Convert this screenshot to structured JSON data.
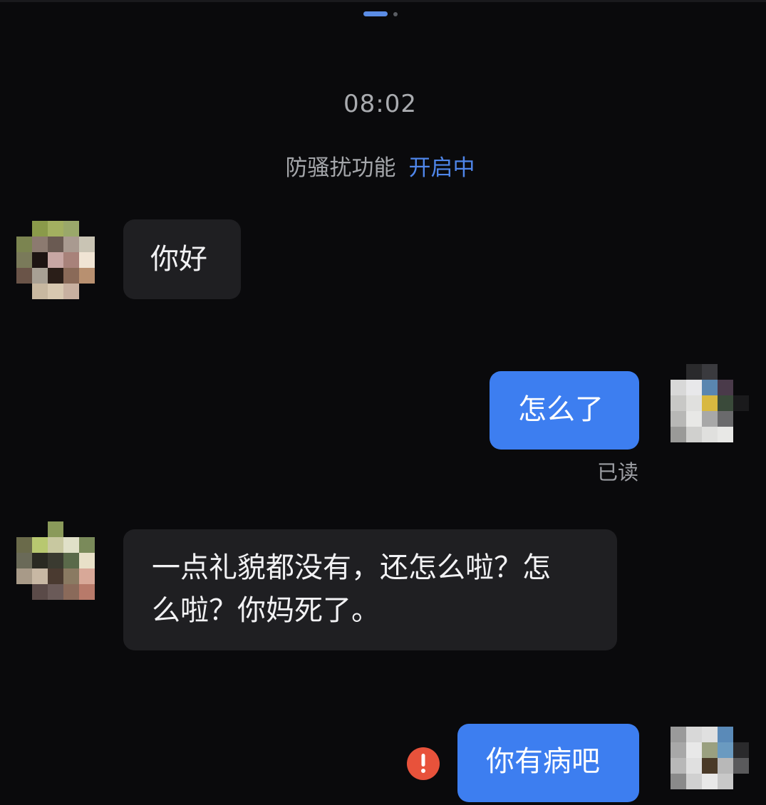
{
  "chat": {
    "timestamp": "08:02",
    "notice": {
      "text": "防骚扰功能",
      "status": "开启中"
    },
    "messages": [
      {
        "direction": "incoming",
        "text": "你好"
      },
      {
        "direction": "outgoing",
        "text": "怎么了",
        "receipt": "已读"
      },
      {
        "direction": "incoming",
        "text_line1": "一点礼貌都没有，还怎么啦？怎",
        "text_line2": "么啦？你妈死了。"
      },
      {
        "direction": "outgoing",
        "text": "你有病吧",
        "failed": true
      }
    ]
  },
  "colors": {
    "background": "#0a0a0c",
    "incoming_bubble": "#1f1f22",
    "outgoing_bubble": "#3d7ef0",
    "accent_blue": "#4f86ea",
    "error_red": "#e8523b"
  }
}
